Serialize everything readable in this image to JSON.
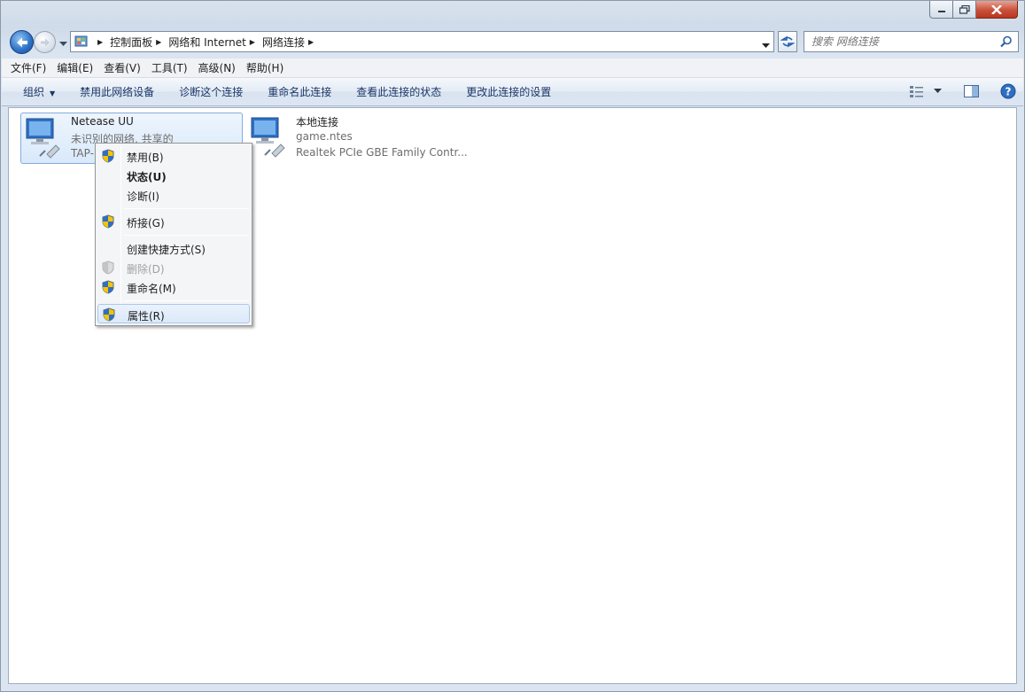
{
  "address": {
    "breadcrumbs": [
      "控制面板",
      "网络和 Internet",
      "网络连接"
    ]
  },
  "search": {
    "placeholder": "搜索 网络连接"
  },
  "menubar": {
    "items": [
      "文件(F)",
      "编辑(E)",
      "查看(V)",
      "工具(T)",
      "高级(N)",
      "帮助(H)"
    ]
  },
  "commandbar": {
    "organize": "组织",
    "commands": [
      "禁用此网络设备",
      "诊断这个连接",
      "重命名此连接",
      "查看此连接的状态",
      "更改此连接的设置"
    ]
  },
  "connections": [
    {
      "name": "Netease UU",
      "status": "未识别的网络, 共享的",
      "device": "TAP-"
    },
    {
      "name": "本地连接",
      "status": "game.ntes",
      "device": "Realtek PCIe GBE Family Contr..."
    }
  ],
  "context_menu": {
    "items": [
      {
        "label": "禁用(B)",
        "icon": "uac-shield-icon"
      },
      {
        "label": "状态(U)",
        "icon": ""
      },
      {
        "label": "诊断(I)",
        "icon": ""
      },
      {
        "label": "桥接(G)",
        "icon": "uac-shield-icon"
      },
      {
        "label": "创建快捷方式(S)",
        "icon": ""
      },
      {
        "label": "删除(D)",
        "icon": "uac-shield-icon"
      },
      {
        "label": "重命名(M)",
        "icon": "uac-shield-icon"
      },
      {
        "label": "属性(R)",
        "icon": "uac-shield-icon"
      }
    ]
  },
  "colors": {
    "selection_border": "#84acdd",
    "link_text": "#1a3566",
    "close_button": "#c9503a"
  }
}
